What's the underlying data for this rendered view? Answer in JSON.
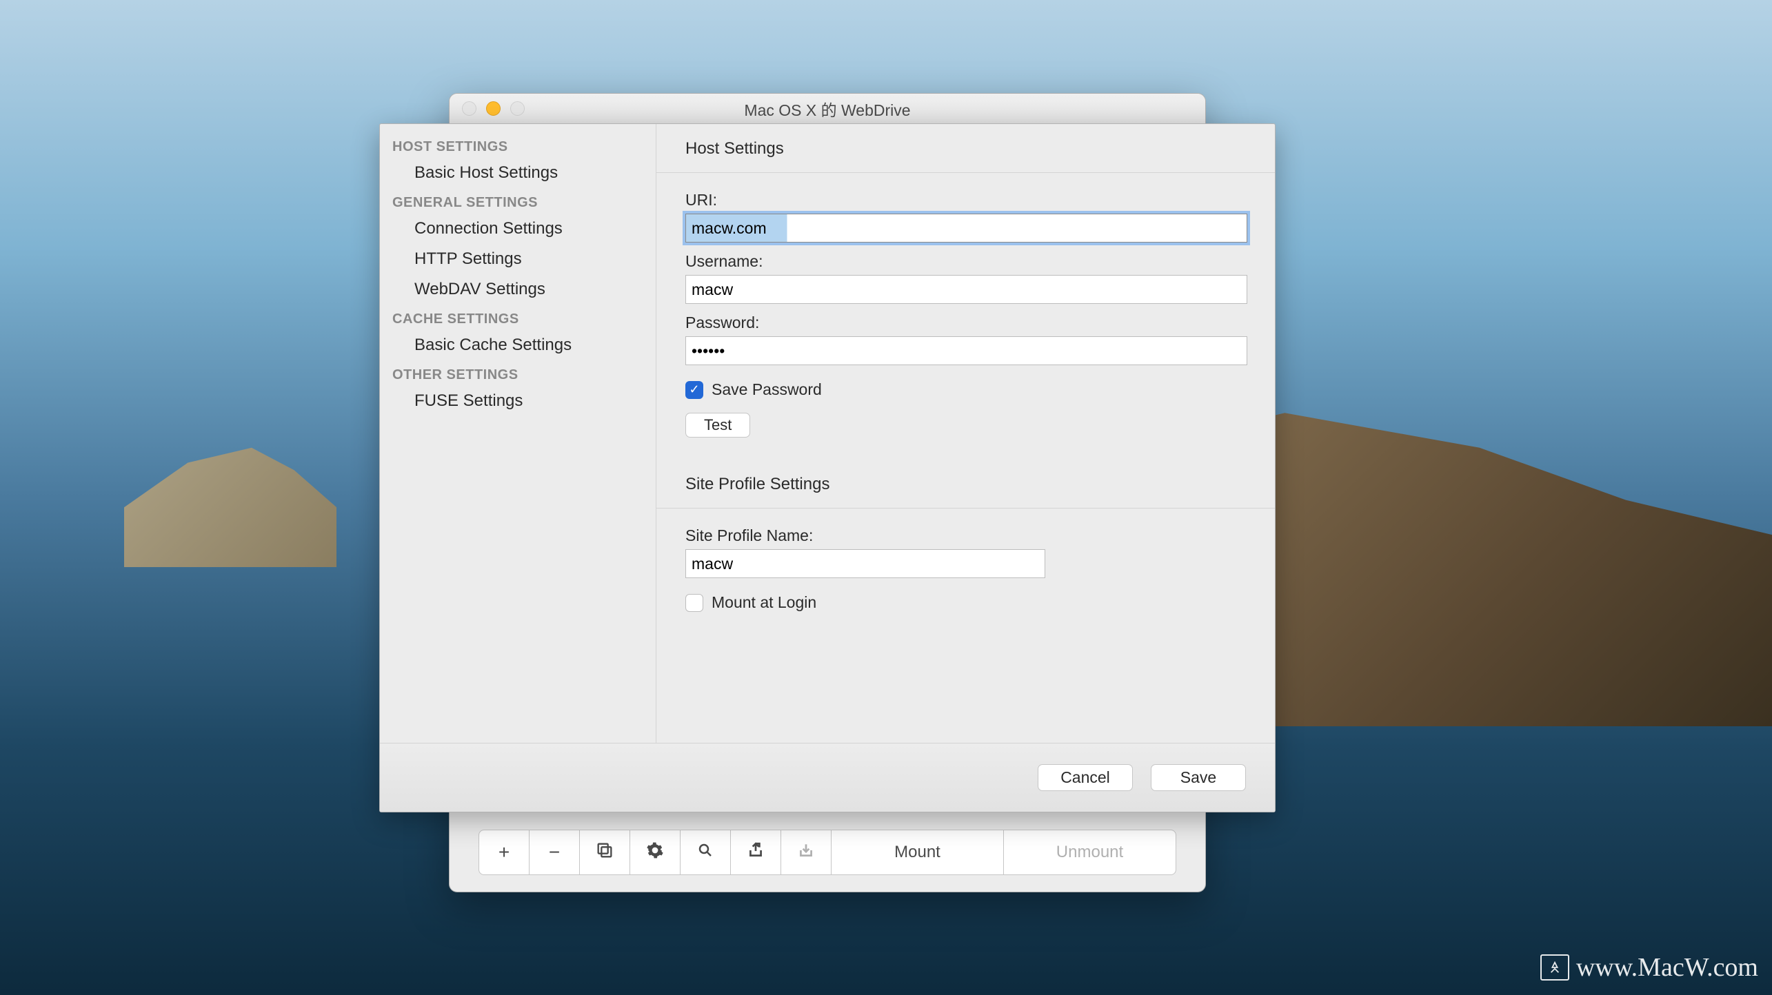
{
  "window": {
    "title": "Mac OS X 的 WebDrive"
  },
  "sidebar": {
    "groups": [
      {
        "header": "HOST SETTINGS",
        "items": [
          {
            "label": "Basic Host Settings"
          }
        ]
      },
      {
        "header": "GENERAL SETTINGS",
        "items": [
          {
            "label": "Connection Settings"
          },
          {
            "label": "HTTP Settings"
          },
          {
            "label": "WebDAV Settings"
          }
        ]
      },
      {
        "header": "CACHE SETTINGS",
        "items": [
          {
            "label": "Basic Cache Settings"
          }
        ]
      },
      {
        "header": "OTHER SETTINGS",
        "items": [
          {
            "label": "FUSE Settings"
          }
        ]
      }
    ]
  },
  "host_settings": {
    "section_title": "Host Settings",
    "uri_label": "URI:",
    "uri_value": "macw.com",
    "username_label": "Username:",
    "username_value": "macw",
    "password_label": "Password:",
    "password_value": "••••••",
    "save_password_label": "Save Password",
    "test_label": "Test"
  },
  "site_profile": {
    "section_title": "Site Profile Settings",
    "name_label": "Site Profile Name:",
    "name_value": "macw",
    "mount_login_label": "Mount at Login"
  },
  "footer": {
    "cancel": "Cancel",
    "save": "Save"
  },
  "toolbar": {
    "mount": "Mount",
    "unmount": "Unmount"
  },
  "watermark": "www.MacW.com"
}
